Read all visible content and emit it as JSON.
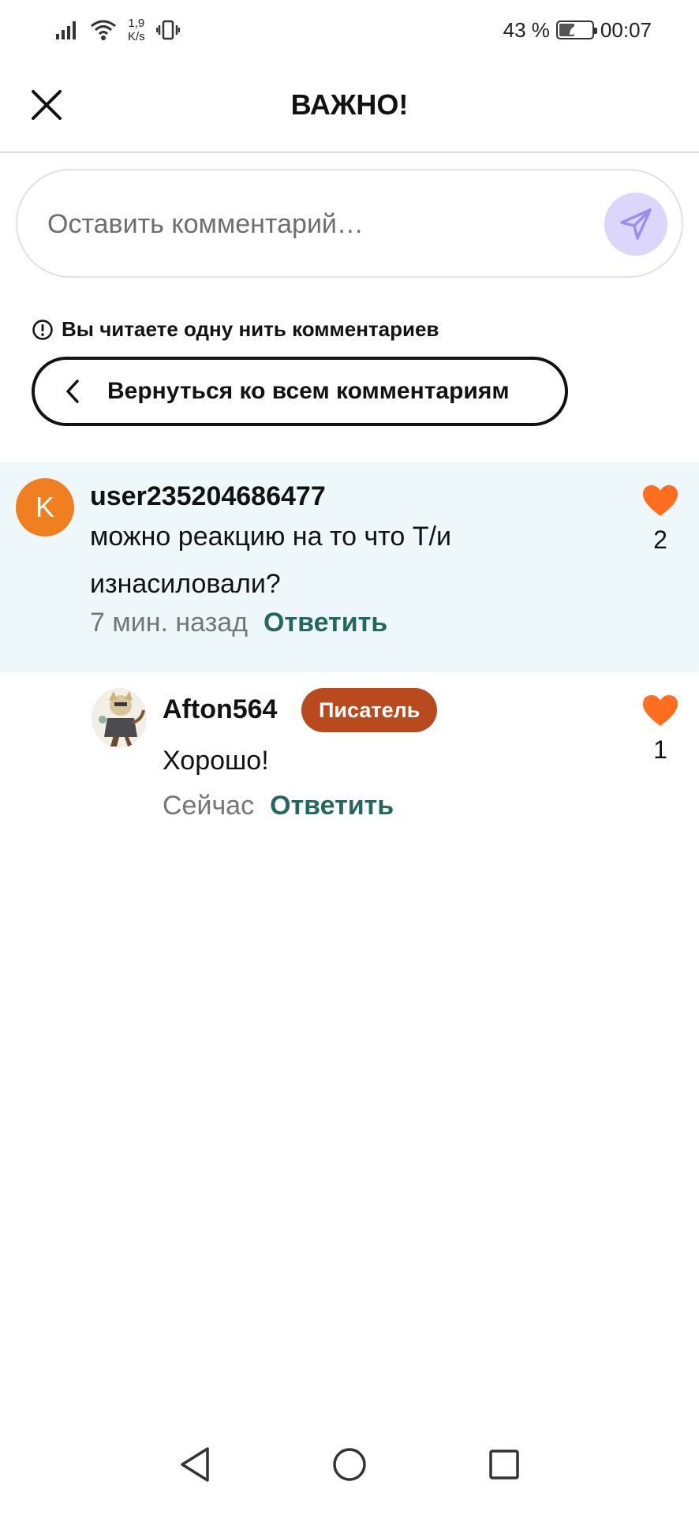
{
  "status_bar": {
    "net_speed_value": "1,9",
    "net_speed_unit": "K/s",
    "battery_percent": "43 %",
    "battery_level": 0.43,
    "time": "00:07"
  },
  "header": {
    "title": "ВАЖНО!"
  },
  "comment_input": {
    "placeholder": "Оставить комментарий…"
  },
  "thread": {
    "info_text": "Вы читаете одну нить комментариев",
    "back_label": "Вернуться ко всем комментариям"
  },
  "comments": [
    {
      "avatar_letter": "K",
      "username": "user235204686477",
      "text": "можно реакцию на то что Т/и изнасиловали?",
      "time": "7 мин. назад",
      "reply_label": "Ответить",
      "likes": "2"
    },
    {
      "username": "Afton564",
      "badge": "Писатель",
      "text": "Хорошо!",
      "time": "Сейчас",
      "reply_label": "Ответить",
      "likes": "1"
    }
  ],
  "colors": {
    "accent_reply": "#23675e",
    "heart": "#ff6d1f",
    "avatar_k": "#f07f22",
    "badge": "#b84a1d",
    "highlight_bg": "#eef8fa",
    "send_btn": "#ddd6fb"
  },
  "icons": {
    "close": "close-icon",
    "send": "send-icon",
    "info": "info-icon",
    "back": "chevron-left-icon",
    "like": "heart-icon",
    "nav_back": "nav-back-icon",
    "nav_home": "nav-home-icon",
    "nav_recent": "nav-recent-icon"
  }
}
